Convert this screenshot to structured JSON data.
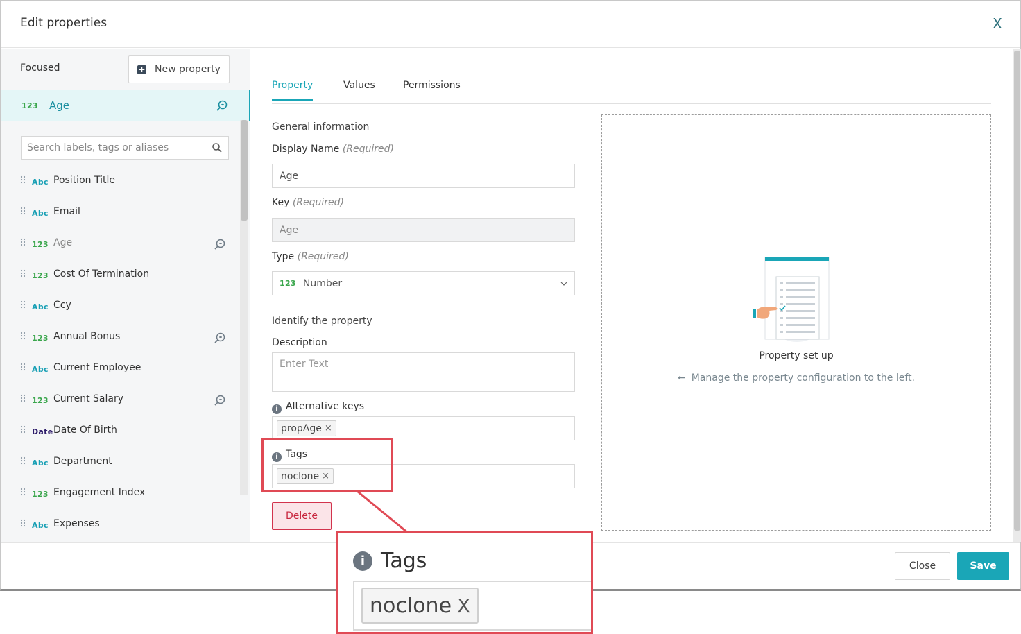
{
  "header": {
    "title": "Edit properties",
    "close_glyph": "X"
  },
  "left": {
    "focused_label": "Focused",
    "new_property_label": "New property",
    "focused_item": {
      "type": "123",
      "name": "Age"
    },
    "search": {
      "placeholder": "Search labels, tags or aliases"
    },
    "items": [
      {
        "type": "Abc",
        "name": "Position Title",
        "zoom": false,
        "dim": false
      },
      {
        "type": "Abc",
        "name": "Email",
        "zoom": false,
        "dim": false
      },
      {
        "type": "123",
        "name": "Age",
        "zoom": true,
        "dim": true
      },
      {
        "type": "123",
        "name": "Cost Of Termination",
        "zoom": false,
        "dim": false
      },
      {
        "type": "Abc",
        "name": "Ccy",
        "zoom": false,
        "dim": false
      },
      {
        "type": "123",
        "name": "Annual Bonus",
        "zoom": true,
        "dim": false
      },
      {
        "type": "Abc",
        "name": "Current Employee",
        "zoom": false,
        "dim": false
      },
      {
        "type": "123",
        "name": "Current Salary",
        "zoom": true,
        "dim": false
      },
      {
        "type": "Date",
        "name": "Date Of Birth",
        "zoom": false,
        "dim": false
      },
      {
        "type": "Abc",
        "name": "Department",
        "zoom": false,
        "dim": false
      },
      {
        "type": "123",
        "name": "Engagement Index",
        "zoom": false,
        "dim": false
      },
      {
        "type": "Abc",
        "name": "Expenses",
        "zoom": false,
        "dim": false
      }
    ]
  },
  "tabs": [
    {
      "label": "Property",
      "active": true
    },
    {
      "label": "Values",
      "active": false
    },
    {
      "label": "Permissions",
      "active": false
    }
  ],
  "form": {
    "general_title": "General information",
    "display_name_label": "Display Name",
    "required_text": "(Required)",
    "display_name_value": "Age",
    "key_label": "Key",
    "key_value": "Age",
    "type_label": "Type",
    "type_badge": "123",
    "type_value": "Number",
    "identify_title": "Identify the property",
    "description_label": "Description",
    "description_placeholder": "Enter Text",
    "alt_keys_label": "Alternative keys",
    "alt_keys": [
      "propAge"
    ],
    "tags_label": "Tags",
    "tags": [
      "noclone"
    ],
    "delete_label": "Delete",
    "info_glyph": "i",
    "chip_remove_glyph": "×"
  },
  "setup": {
    "title": "Property set up",
    "subtitle": "Manage the property configuration to the left.",
    "arrow_glyph": "←"
  },
  "footer": {
    "close_label": "Close",
    "save_label": "Save"
  },
  "callout": {
    "tags_label": "Tags",
    "tag": "noclone",
    "remove_glyph": "X"
  },
  "colors": {
    "accent": "#1aa6b7",
    "danger": "#d2334d",
    "highlight": "#e04a55",
    "num_badge": "#3aa64c",
    "abc_badge": "#1aa0b5",
    "date_badge": "#2f1e6b"
  }
}
